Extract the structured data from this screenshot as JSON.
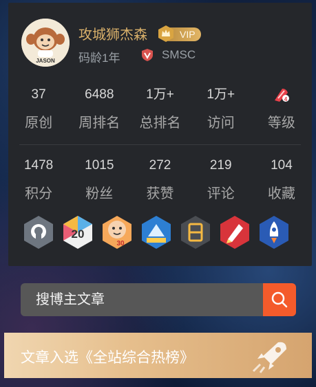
{
  "profile": {
    "name": "攻城狮杰森",
    "vip_label": "VIP",
    "years": "码龄1年",
    "org": "SMSC",
    "avatar_text": "JASON"
  },
  "stats_row1": [
    {
      "value": "37",
      "label": "原创"
    },
    {
      "value": "6488",
      "label": "周排名"
    },
    {
      "value": "1万+",
      "label": "总排名"
    },
    {
      "value": "1万+",
      "label": "访问"
    },
    {
      "value": "",
      "label": "等级",
      "icon": "level-4-icon"
    }
  ],
  "stats_row2": [
    {
      "value": "1478",
      "label": "积分"
    },
    {
      "value": "1015",
      "label": "粉丝"
    },
    {
      "value": "272",
      "label": "获赞"
    },
    {
      "value": "219",
      "label": "评论"
    },
    {
      "value": "104",
      "label": "收藏"
    }
  ],
  "badges": [
    {
      "name": "github-badge-icon"
    },
    {
      "name": "20-days-badge-icon",
      "text": "20"
    },
    {
      "name": "30-days-monkey-badge-icon",
      "text": "30"
    },
    {
      "name": "blue-community-badge-icon"
    },
    {
      "name": "heng-badge-icon"
    },
    {
      "name": "pen-badge-icon"
    },
    {
      "name": "rocket-badge-icon"
    }
  ],
  "search": {
    "placeholder": "搜博主文章"
  },
  "banner": {
    "text": "文章入选《全站综合热榜》"
  },
  "colors": {
    "accent_orange": "#f45b2b",
    "name_gold": "#d9b06a",
    "card_bg": "#25272b"
  }
}
